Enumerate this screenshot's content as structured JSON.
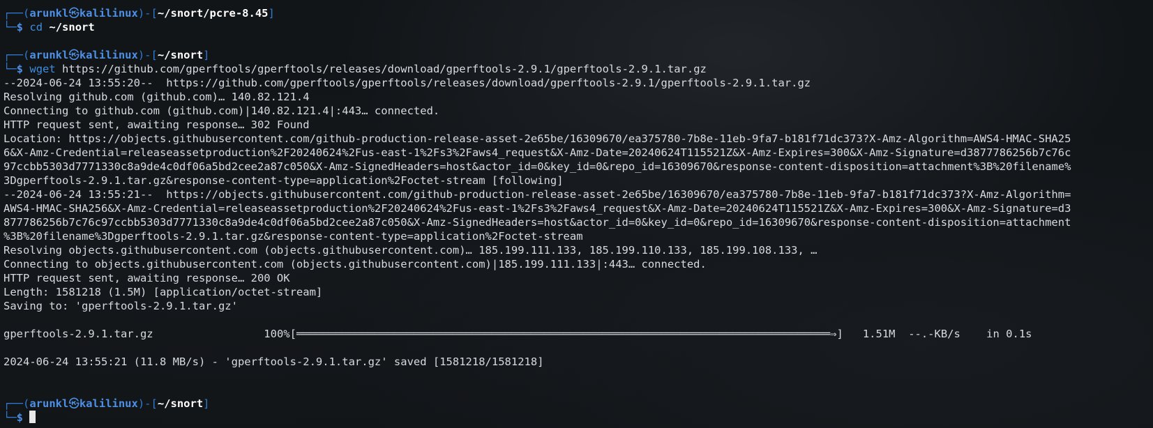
{
  "prompt": {
    "user": "arunkl",
    "at": "㉿",
    "host": "kalilinux",
    "open": "┌──(",
    "close": ")-[",
    "end": "]",
    "corner": "└─",
    "dollar": "$"
  },
  "blocks": [
    {
      "path": "~/snort/pcre-8.45",
      "command": "cd",
      "argument": "~/snort",
      "output": []
    },
    {
      "path": "~/snort",
      "command": "wget",
      "argument": "https://github.com/gperftools/gperftools/releases/download/gperftools-2.9.1/gperftools-2.9.1.tar.gz",
      "output": [
        "--2024-06-24 13:55:20--  https://github.com/gperftools/gperftools/releases/download/gperftools-2.9.1/gperftools-2.9.1.tar.gz",
        "Resolving github.com (github.com)… 140.82.121.4",
        "Connecting to github.com (github.com)|140.82.121.4|:443… connected.",
        "HTTP request sent, awaiting response… 302 Found",
        "Location: https://objects.githubusercontent.com/github-production-release-asset-2e65be/16309670/ea375780-7b8e-11eb-9fa7-b181f71dc373?X-Amz-Algorithm=AWS4-HMAC-SHA25",
        "6&X-Amz-Credential=releaseassetproduction%2F20240624%2Fus-east-1%2Fs3%2Faws4_request&X-Amz-Date=20240624T115521Z&X-Amz-Expires=300&X-Amz-Signature=d3877786256b7c76c",
        "97ccbb5303d7771330c8a9de4c0df06a5bd2cee2a87c050&X-Amz-SignedHeaders=host&actor_id=0&key_id=0&repo_id=16309670&response-content-disposition=attachment%3B%20filename%",
        "3Dgperftools-2.9.1.tar.gz&response-content-type=application%2Foctet-stream [following]",
        "--2024-06-24 13:55:21--  https://objects.githubusercontent.com/github-production-release-asset-2e65be/16309670/ea375780-7b8e-11eb-9fa7-b181f71dc373?X-Amz-Algorithm=",
        "AWS4-HMAC-SHA256&X-Amz-Credential=releaseassetproduction%2F20240624%2Fus-east-1%2Fs3%2Faws4_request&X-Amz-Date=20240624T115521Z&X-Amz-Expires=300&X-Amz-Signature=d3",
        "877786256b7c76c97ccbb5303d7771330c8a9de4c0df06a5bd2cee2a87c050&X-Amz-SignedHeaders=host&actor_id=0&key_id=0&repo_id=16309670&response-content-disposition=attachment",
        "%3B%20filename%3Dgperftools-2.9.1.tar.gz&response-content-type=application%2Foctet-stream",
        "Resolving objects.githubusercontent.com (objects.githubusercontent.com)… 185.199.111.133, 185.199.110.133, 185.199.108.133, …",
        "Connecting to objects.githubusercontent.com (objects.githubusercontent.com)|185.199.111.133|:443… connected.",
        "HTTP request sent, awaiting response… 200 OK",
        "Length: 1581218 (1.5M) [application/octet-stream]",
        "Saving to: 'gperftools-2.9.1.tar.gz'"
      ],
      "progress": {
        "filename": "gperftools-2.9.1.tar.gz",
        "percent_label": "100%[",
        "bar": "══════════════════════════════════════════════════════════════════════════════════⇒",
        "bar_end": "]",
        "size": "1.51M",
        "rate": "--.-KB/s",
        "time": "in 0.1s",
        "percent": 100
      },
      "saved": "2024-06-24 13:55:21 (11.8 MB/s) - 'gperftools-2.9.1.tar.gz' saved [1581218/1581218]"
    },
    {
      "path": "~/snort",
      "command": "",
      "argument": "",
      "output": []
    }
  ]
}
